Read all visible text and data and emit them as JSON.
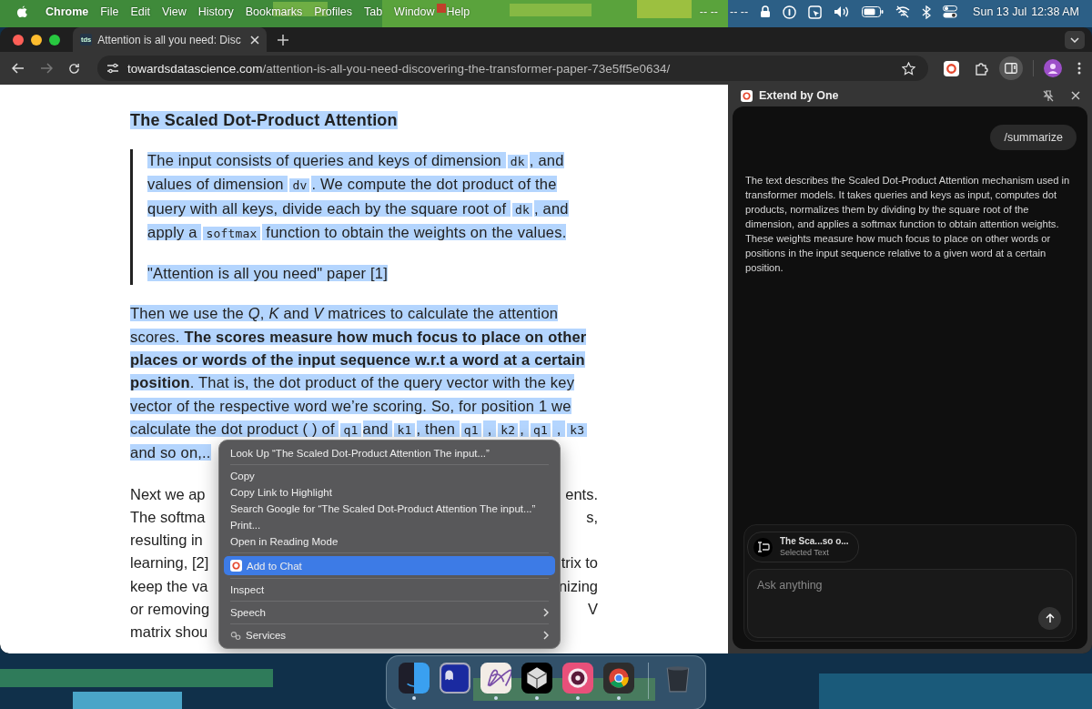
{
  "menu_bar": {
    "app": "Chrome",
    "menus": [
      "File",
      "Edit",
      "View",
      "History",
      "Bookmarks",
      "Profiles",
      "Tab",
      "Window",
      "Help"
    ],
    "status_texts": [
      "-- --",
      "-- --"
    ],
    "date": "Sun 13 Jul",
    "time": "12:38 AM"
  },
  "tabs": [
    {
      "favicon": "tds",
      "title": "Attention is all you need: Disc",
      "selected": true
    }
  ],
  "address_bar": {
    "domain": "towardsdatascience.com",
    "path": "/attention-is-all-you-need-discovering-the-transformer-paper-73e5ff5e0634/"
  },
  "article": {
    "heading": "The Scaled Dot-Product Attention",
    "quote_lines": [
      [
        {
          "kind": "text",
          "text": "The input consists of queries and keys of dimension "
        },
        {
          "kind": "code",
          "text": "dk"
        },
        {
          "kind": "text",
          "text": ", and"
        }
      ],
      [
        {
          "kind": "text",
          "text": "values of dimension "
        },
        {
          "kind": "code",
          "text": "dv"
        },
        {
          "kind": "text",
          "text": ". We compute the dot product of the"
        }
      ],
      [
        {
          "kind": "text",
          "text": "query with all keys, divide each by the square root of "
        },
        {
          "kind": "code",
          "text": "dk"
        },
        {
          "kind": "text",
          "text": ", and"
        }
      ],
      [
        {
          "kind": "text",
          "text": "apply a "
        },
        {
          "kind": "code",
          "text": "softmax"
        },
        {
          "kind": "text",
          "text": " function to obtain the weights on the values."
        }
      ]
    ],
    "quote_caption": "\"Attention is all you need\" paper [1]",
    "paragraph_lines": [
      [
        {
          "kind": "text",
          "text": "Then we use the *Q*, *K* and *V* matrices to calculate the attention"
        }
      ],
      [
        {
          "kind": "text",
          "text": "scores. **The scores measure how much focus to place on other**"
        }
      ],
      [
        {
          "kind": "text",
          "text": "**places or words of the input sequence w.r.t a word at a certain**"
        }
      ],
      [
        {
          "kind": "text",
          "text": "**position**. That is, the dot product of the query vector with the key"
        }
      ],
      [
        {
          "kind": "text",
          "text": "vector of the respective word we’re scoring. So, for position 1 we"
        }
      ],
      [
        {
          "kind": "text",
          "text": "calculate the dot product ( ) of "
        },
        {
          "kind": "code",
          "text": "q1"
        },
        {
          "kind": "text",
          "text": "and "
        },
        {
          "kind": "code",
          "text": "k1"
        },
        {
          "kind": "text",
          "text": ", then "
        },
        {
          "kind": "code",
          "text": "q1"
        },
        {
          "kind": "text",
          "text": " , "
        },
        {
          "kind": "code",
          "text": "k2"
        },
        {
          "kind": "text",
          "text": ", "
        },
        {
          "kind": "code",
          "text": "q1"
        },
        {
          "kind": "text",
          "text": " , "
        },
        {
          "kind": "code",
          "text": "k3"
        }
      ],
      [
        {
          "kind": "text",
          "text": "and so on,.."
        }
      ]
    ],
    "covered_lines": [
      {
        "left": "Next we ap",
        "right": "ents."
      },
      {
        "left": "The softma",
        "right": "s,"
      },
      {
        "left": "resulting in"
      },
      {
        "left": "learning, [2]",
        "right": "trix to"
      },
      {
        "left": "keep the va",
        "right": "nizing"
      },
      {
        "left": "or removing",
        "right": "V"
      },
      {
        "left": "matrix shou"
      }
    ]
  },
  "context_menu": {
    "groups": [
      [
        {
          "kind": "plain",
          "label": "Look Up “The Scaled Dot-Product Attention The input...”",
          "submenu": false,
          "selected": false
        }
      ],
      [
        {
          "kind": "plain",
          "label": "Copy",
          "submenu": false,
          "selected": false
        },
        {
          "kind": "plain",
          "label": "Copy Link to Highlight",
          "submenu": false,
          "selected": false
        },
        {
          "kind": "plain",
          "label": "Search Google for “The Scaled Dot-Product Attention The input...”",
          "submenu": false,
          "selected": false
        },
        {
          "kind": "plain",
          "label": "Print...",
          "submenu": false,
          "selected": false
        },
        {
          "kind": "plain",
          "label": "Open in Reading Mode",
          "submenu": false,
          "selected": false
        }
      ],
      [
        {
          "kind": "extension",
          "label": "Add to Chat",
          "submenu": false,
          "selected": true
        }
      ],
      [
        {
          "kind": "plain",
          "label": "Inspect",
          "submenu": false,
          "selected": false
        }
      ],
      [
        {
          "kind": "plain",
          "label": "Speech",
          "submenu": true,
          "selected": false
        }
      ],
      [
        {
          "kind": "services",
          "label": "Services",
          "submenu": true,
          "selected": false
        }
      ]
    ]
  },
  "side_panel": {
    "title": "Extend by One",
    "user_message": "/summarize",
    "reply": "The text describes the Scaled Dot-Product Attention mechanism used in transformer models. It takes queries and keys as input, computes dot products, normalizes them by dividing by the square root of the dimension, and applies a softmax function to obtain attention weights. These weights measure how much focus to place on other words or positions in the input sequence relative to a given word at a certain position.",
    "attachment": {
      "title": "The Sca...so o...",
      "subtitle": "Selected Text"
    },
    "input": {
      "placeholder": "Ask anything"
    }
  },
  "dock": {
    "apps": [
      {
        "kind": "finder",
        "running": true
      },
      {
        "kind": "terminal",
        "running": false
      },
      {
        "kind": "scribble",
        "running": true
      },
      {
        "kind": "cube",
        "running": true
      },
      {
        "kind": "target",
        "running": true
      },
      {
        "kind": "browser",
        "running": true
      },
      {
        "kind": "trash",
        "running": false
      }
    ]
  }
}
